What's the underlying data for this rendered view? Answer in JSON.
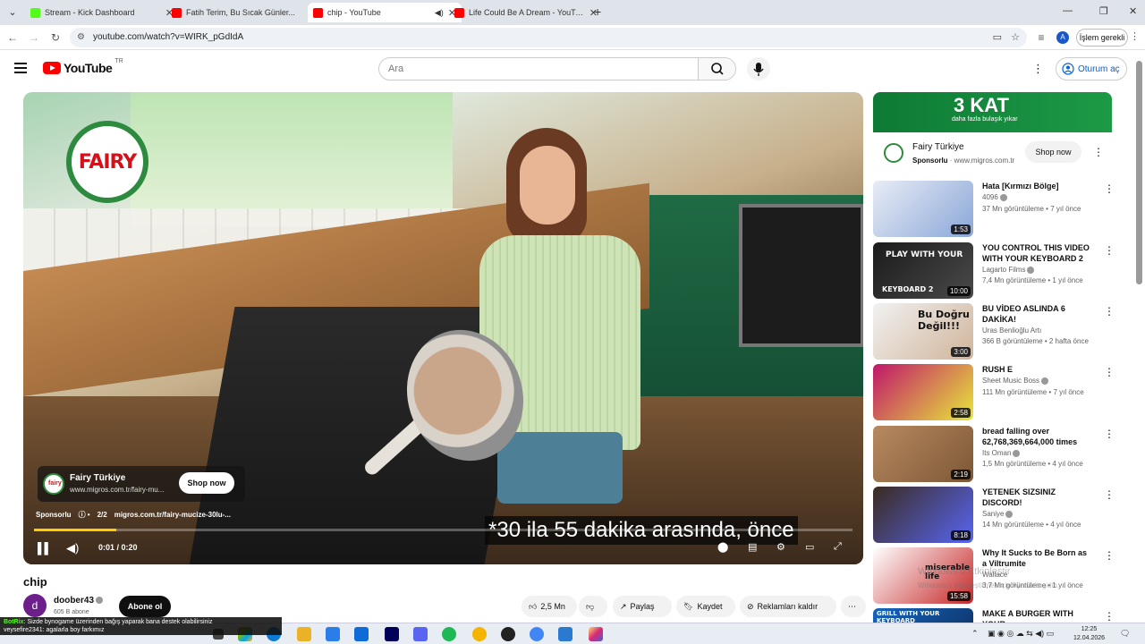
{
  "browser": {
    "tabs": [
      {
        "title": "Stream - Kick Dashboard",
        "favicon_color": "#53fc18",
        "active": false
      },
      {
        "title": "Fatih Terim, Bu Sıcak Günler...",
        "favicon_color": "#ff0000",
        "active": false
      },
      {
        "title": "chip - YouTube",
        "favicon_color": "#ff0000",
        "active": true
      },
      {
        "title": "Life Could Be A Dream - YouTube",
        "favicon_color": "#ff0000",
        "active": false
      }
    ],
    "url": "youtube.com/watch?v=WIRK_pGdIdA",
    "profile_initial": "A",
    "update_button": "İşlem gerekli"
  },
  "youtube": {
    "logo_text": "YouTube",
    "country_code": "TR",
    "search_placeholder": "Ara",
    "signin_label": "Oturum aç"
  },
  "player": {
    "ad_brand_logo": "FAIRY",
    "ad_advertiser": "Fairy Türkiye",
    "ad_url": "www.migros.com.tr/fairy-mu...",
    "ad_shop_label": "Shop now",
    "ad_sponsored": "Sponsorlu",
    "ad_count": "2/2",
    "ad_link": "migros.com.tr/fairy-mucize-30lu-...",
    "current_time": "0:01",
    "duration": "0:20",
    "progress_percent": 10,
    "caption": "*30 ila 55 dakika arasında, önce",
    "progress_color": "#ffcc00"
  },
  "video": {
    "title": "chip",
    "channel_initial": "d",
    "channel_name": "doober43",
    "subscribers": "605 B abone",
    "subscribe_label": "Abone ol",
    "likes": "2,5 Mn",
    "share_label": "Paylaş",
    "save_label": "Kaydet",
    "remove_ads_label": "Reklamları kaldır"
  },
  "sidebar_ad": {
    "banner_big": "3 KAT",
    "banner_small": "daha fazla bulaşık yıkar",
    "advertiser": "Fairy Türkiye",
    "sponsored": "Sponsorlu",
    "domain": "www.migros.com.tr",
    "shop_label": "Shop now"
  },
  "recommendations": [
    {
      "title": "Hata [Kırmızı Bölge]",
      "channel": "4096",
      "verified": true,
      "views": "37 Mn görüntüleme",
      "age": "7 yıl önce",
      "duration": "1:53",
      "thumb_a": "#e8ecf5",
      "thumb_b": "#8aa7d8"
    },
    {
      "title": "YOU CONTROL THIS VIDEO WITH YOUR KEYBOARD 2",
      "channel": "Lagarto Films",
      "verified": true,
      "views": "7,4 Mn görüntüleme",
      "age": "1 yıl önce",
      "duration": "10:00",
      "thumb_a": "#1b1b1b",
      "thumb_b": "#4a4a4a"
    },
    {
      "title": "BU VİDEO ASLINDA 6 DAKİKA!",
      "channel": "Uras Benlioğlu Artı",
      "verified": false,
      "views": "366 B görüntüleme",
      "age": "2 hafta önce",
      "duration": "3:00",
      "thumb_a": "#f1f1f1",
      "thumb_b": "#d0b49a"
    },
    {
      "title": "RUSH E",
      "channel": "Sheet Music Boss",
      "verified": true,
      "views": "111 Mn görüntüleme",
      "age": "7 yıl önce",
      "duration": "2:58",
      "thumb_a": "#c0166b",
      "thumb_b": "#e8e83a"
    },
    {
      "title": "bread falling over 62,768,369,664,000 times",
      "channel": "Its Oman",
      "verified": true,
      "views": "1,5 Mn görüntüleme",
      "age": "4 yıl önce",
      "duration": "2:19",
      "thumb_a": "#b88a60",
      "thumb_b": "#7c5736"
    },
    {
      "title": "YETENEK SIZSINIZ DISCORD!",
      "channel": "Saniye",
      "verified": true,
      "views": "14 Mn görüntüleme",
      "age": "4 yıl önce",
      "duration": "8:18",
      "thumb_a": "#3a2b20",
      "thumb_b": "#5865f2"
    },
    {
      "title": "Why It Sucks to Be Born as a Viltrumite",
      "channel": "Wallace",
      "verified": false,
      "views": "3,7 Mn görüntüleme",
      "age": "1 yıl önce",
      "duration": "15:58",
      "thumb_a": "#ffffff",
      "thumb_b": "#c62828"
    },
    {
      "title": "MAKE A BURGER WITH YOUR",
      "channel": "",
      "verified": false,
      "views": "",
      "age": "",
      "duration": "",
      "thumb_a": "#1565c0",
      "thumb_b": "#0d2a55"
    }
  ],
  "thumb_texts": {
    "kb_top": "PLAY WITH YOUR",
    "kb_bottom": "KEYBOARD 2",
    "bu_dogru": "Bu Doğru Değil!!!",
    "miserable_life": "miserable life",
    "make_burger": "GRILL WITH YOUR KEYBOARD"
  },
  "watermark": {
    "line1": "Windows'u Etkinleştir",
    "line2": "Windows'u etkinleştirmek için Ayarlar'a gidin."
  },
  "stream_overlay": {
    "bot": "BotRix",
    "line1": "Sizde bynogame üzerinden bağış yaparak bana destek olabilirsiniz",
    "line2": "veysefire2341: agalarla boy farkımız"
  },
  "taskbar": {
    "time": "12:25",
    "date": "12.04.2026"
  }
}
